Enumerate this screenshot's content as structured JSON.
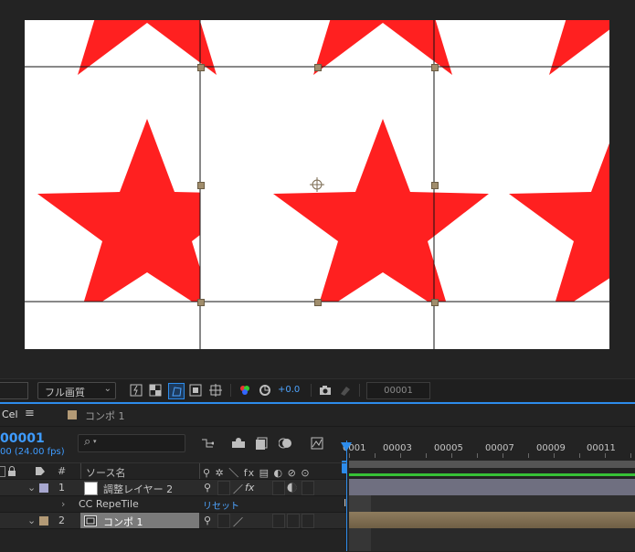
{
  "viewer": {
    "resolution": "フル画質",
    "resolution_caret": "⌄",
    "exposure": "+0.0",
    "frame": "00001",
    "colors": {
      "star": "#ff2020",
      "grid": "#111111",
      "handle": "#a08d6c"
    }
  },
  "timeline": {
    "panel_tab": "Cel",
    "panel_menu": "≡",
    "comp_tab": "コンポ 1",
    "comp_tab_color": "#b39a76",
    "current_time": "00001",
    "fps": "00 (24.00 fps)",
    "search_icon": "⌕",
    "headers": {
      "hash": "#",
      "source": "ソース名",
      "switches": "⚲ ✲ ＼ fx ▤ ◐ ⊘ ⊙"
    },
    "ruler_labels": [
      "0001",
      "00003",
      "00005",
      "00007",
      "00009",
      "00011"
    ],
    "layers": [
      {
        "num": "1",
        "label_color": "#a7a7cf",
        "name": "調整レイヤー 2",
        "switch_a": "⚲",
        "switch_b": "fx"
      },
      {
        "effect": "CC RepeTile",
        "reset": "リセット"
      },
      {
        "num": "2",
        "label_color": "#b39a76",
        "name": "コンポ 1",
        "switch_a": "⚲"
      }
    ]
  }
}
